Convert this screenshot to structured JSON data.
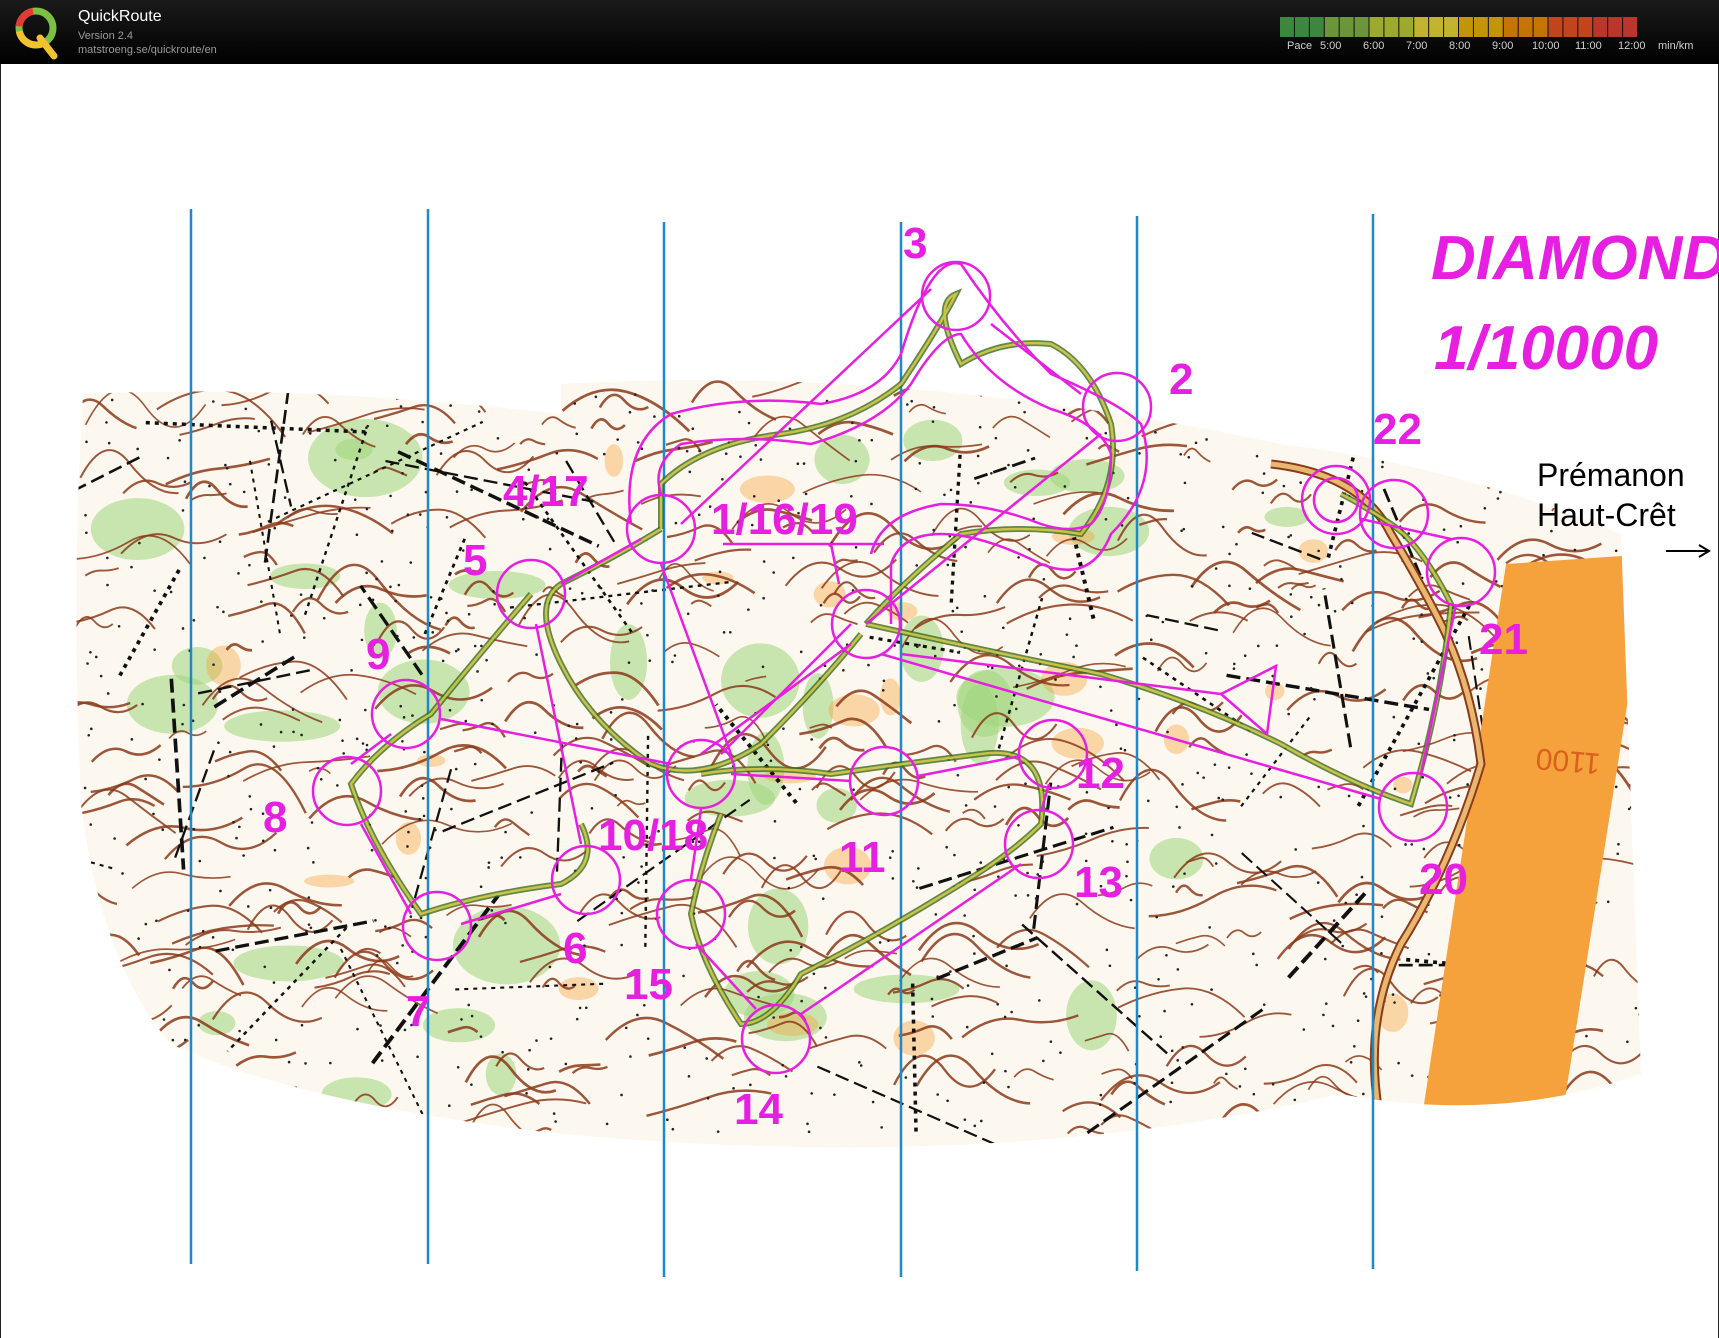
{
  "app": {
    "name": "QuickRoute",
    "version": "Version 2.4",
    "url": "matstroeng.se/quickroute/en"
  },
  "pace_scale": {
    "label": "Pace",
    "ticks": [
      "5:00",
      "6:00",
      "7:00",
      "8:00",
      "9:00",
      "10:00",
      "11:00",
      "12:00"
    ],
    "unit": "min/km",
    "colors": [
      "#4caf50",
      "#8bc34a",
      "#cddc39",
      "#ffeb3b",
      "#ffc107",
      "#ff9800",
      "#ff5722",
      "#f44336"
    ]
  },
  "map": {
    "title": "DIAMOND",
    "scale": "1/10000",
    "destination_line1": "Prémanon",
    "destination_line2": "Haut-Crêt",
    "contour_label": "1100",
    "controls": [
      {
        "label": "1/16/19"
      },
      {
        "label": "2"
      },
      {
        "label": "3"
      },
      {
        "label": "4/17"
      },
      {
        "label": "5"
      },
      {
        "label": "6"
      },
      {
        "label": "7"
      },
      {
        "label": "8"
      },
      {
        "label": "9"
      },
      {
        "label": "10/18"
      },
      {
        "label": "11"
      },
      {
        "label": "12"
      },
      {
        "label": "13"
      },
      {
        "label": "14"
      },
      {
        "label": "15"
      },
      {
        "label": "20"
      },
      {
        "label": "21"
      },
      {
        "label": "22"
      }
    ],
    "colors": {
      "course": "#e61fe1",
      "north_lines": "#1e88c8",
      "contours": "#8b3a1a",
      "open_land": "#f5a23c",
      "vegetation": "#9fd67a",
      "route": "#5a8a2a"
    }
  }
}
